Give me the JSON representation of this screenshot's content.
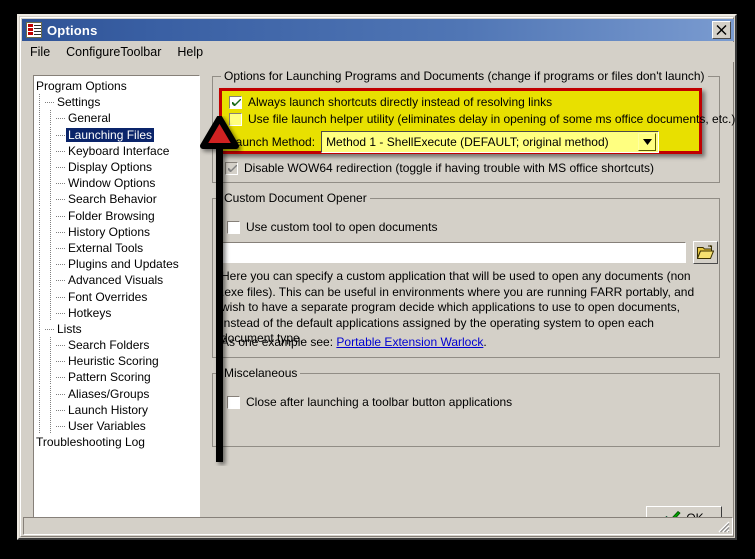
{
  "window": {
    "title": "Options",
    "icon": "options-list-icon",
    "close_label": "x"
  },
  "menubar": {
    "items": [
      {
        "label": "File",
        "name": "menu-file"
      },
      {
        "label": "ConfigureToolbar",
        "name": "menu-configure-toolbar"
      },
      {
        "label": "Help",
        "name": "menu-help"
      }
    ]
  },
  "tree": {
    "items": [
      {
        "label": "Program Options",
        "level": 0,
        "selected": false
      },
      {
        "label": "Settings",
        "level": 1,
        "selected": false
      },
      {
        "label": "General",
        "level": 2,
        "selected": false
      },
      {
        "label": "Launching Files",
        "level": 2,
        "selected": true
      },
      {
        "label": "Keyboard Interface",
        "level": 2,
        "selected": false
      },
      {
        "label": "Display Options",
        "level": 2,
        "selected": false
      },
      {
        "label": "Window Options",
        "level": 2,
        "selected": false
      },
      {
        "label": "Search Behavior",
        "level": 2,
        "selected": false
      },
      {
        "label": "Folder Browsing",
        "level": 2,
        "selected": false
      },
      {
        "label": "History Options",
        "level": 2,
        "selected": false
      },
      {
        "label": "External Tools",
        "level": 2,
        "selected": false
      },
      {
        "label": "Plugins and Updates",
        "level": 2,
        "selected": false
      },
      {
        "label": "Advanced Visuals",
        "level": 2,
        "selected": false
      },
      {
        "label": "Font Overrides",
        "level": 2,
        "selected": false
      },
      {
        "label": "Hotkeys",
        "level": 2,
        "selected": false
      },
      {
        "label": "Lists",
        "level": 1,
        "selected": false
      },
      {
        "label": "Search Folders",
        "level": 2,
        "selected": false
      },
      {
        "label": "Heuristic Scoring",
        "level": 2,
        "selected": false
      },
      {
        "label": "Pattern Scoring",
        "level": 2,
        "selected": false
      },
      {
        "label": "Aliases/Groups",
        "level": 2,
        "selected": false
      },
      {
        "label": "Launch History",
        "level": 2,
        "selected": false
      },
      {
        "label": "User Variables",
        "level": 2,
        "selected": false
      },
      {
        "label": "Troubleshooting Log",
        "level": 0,
        "selected": false
      }
    ]
  },
  "launch_group": {
    "title": "Options for Launching Programs and Documents (change if programs or files don't launch)",
    "always_launch_shortcuts": {
      "label": "Always launch shortcuts directly instead of resolving links",
      "checked": true
    },
    "use_file_launch_helper": {
      "label": "Use file launch helper utility (eliminates delay in opening of some ms office documents, etc.)",
      "checked": false
    },
    "launch_method": {
      "label": "Launch Method:",
      "value": "Method 1 - ShellExecute (DEFAULT; original method)",
      "options": [
        "Method 1 - ShellExecute (DEFAULT; original method)"
      ]
    },
    "disable_wow64": {
      "label": "Disable WOW64 redirection (toggle if having trouble with MS office shortcuts)",
      "checked": true,
      "disabled": true
    }
  },
  "custom_opener_group": {
    "title": "Custom Document Opener",
    "use_custom_tool": {
      "label": "Use custom tool to open documents",
      "checked": false
    },
    "path_field": {
      "value": "",
      "placeholder": ""
    },
    "browse_icon": "open-folder-icon",
    "description": "Here you can specify a custom application that will be used to open any documents (non .exe files).  This can be useful in environments where you are  running FARR portably, and wish to have a separate program decide which applications to use to open documents, instead of the default applications assigned by the operating system to open each document type.",
    "example_prefix": "As one example see: ",
    "example_link": "Portable Extension  Warlock",
    "example_suffix": "."
  },
  "misc_group": {
    "title": "Miscelaneous",
    "close_after_launching": {
      "label": "Close after launching a toolbar button applications",
      "checked": false
    }
  },
  "footer": {
    "ok_accel": "O",
    "ok_rest": "K",
    "ok_icon": "green-check-icon"
  },
  "annotation": {
    "arrow": "red-triangle-arrow-up",
    "arrow_color": "#d02020",
    "shaft_color": "#000000"
  },
  "colors": {
    "highlight_fill": "#e8e000",
    "highlight_border": "#c00000",
    "title_bar": "#3b5ca0",
    "dialog_face": "#d4d0c8",
    "selection": "#0a246a",
    "link": "#0000d0"
  }
}
